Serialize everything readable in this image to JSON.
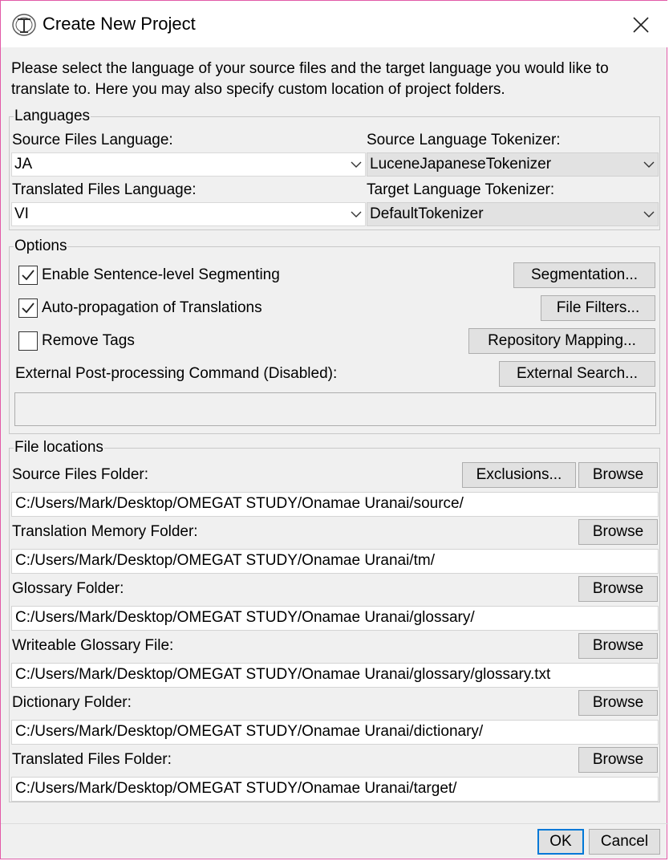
{
  "window": {
    "title": "Create New Project",
    "intro": "Please select the language of your source files and the target language you would like to translate to. Here you may also specify custom location of project folders."
  },
  "languages": {
    "legend": "Languages",
    "source_label": "Source Files Language:",
    "source_value": "JA",
    "source_tokenizer_label": "Source Language Tokenizer:",
    "source_tokenizer_value": "LuceneJapaneseTokenizer",
    "target_label": "Translated Files Language:",
    "target_value": "VI",
    "target_tokenizer_label": "Target Language Tokenizer:",
    "target_tokenizer_value": "DefaultTokenizer"
  },
  "options": {
    "legend": "Options",
    "sentence_seg_label": "Enable Sentence-level Segmenting",
    "sentence_seg_checked": true,
    "auto_prop_label": "Auto-propagation of Translations",
    "auto_prop_checked": true,
    "remove_tags_label": "Remove Tags",
    "remove_tags_checked": false,
    "external_cmd_label": "External Post-processing Command (Disabled):",
    "external_cmd_value": "",
    "segmentation_btn": "Segmentation...",
    "file_filters_btn": "File Filters...",
    "repo_mapping_btn": "Repository Mapping...",
    "external_search_btn": "External Search..."
  },
  "locations": {
    "legend": "File locations",
    "browse_label": "Browse",
    "exclusions_btn": "Exclusions...",
    "folders": [
      {
        "label": "Source Files Folder:",
        "path": "C:/Users/Mark/Desktop/OMEGAT STUDY/Onamae Uranai/source/"
      },
      {
        "label": "Translation Memory Folder:",
        "path": "C:/Users/Mark/Desktop/OMEGAT STUDY/Onamae Uranai/tm/"
      },
      {
        "label": "Glossary Folder:",
        "path": "C:/Users/Mark/Desktop/OMEGAT STUDY/Onamae Uranai/glossary/"
      },
      {
        "label": "Writeable Glossary File:",
        "path": "C:/Users/Mark/Desktop/OMEGAT STUDY/Onamae Uranai/glossary/glossary.txt"
      },
      {
        "label": "Dictionary Folder:",
        "path": "C:/Users/Mark/Desktop/OMEGAT STUDY/Onamae Uranai/dictionary/"
      },
      {
        "label": "Translated Files Folder:",
        "path": "C:/Users/Mark/Desktop/OMEGAT STUDY/Onamae Uranai/target/"
      }
    ]
  },
  "footer": {
    "ok": "OK",
    "cancel": "Cancel"
  }
}
